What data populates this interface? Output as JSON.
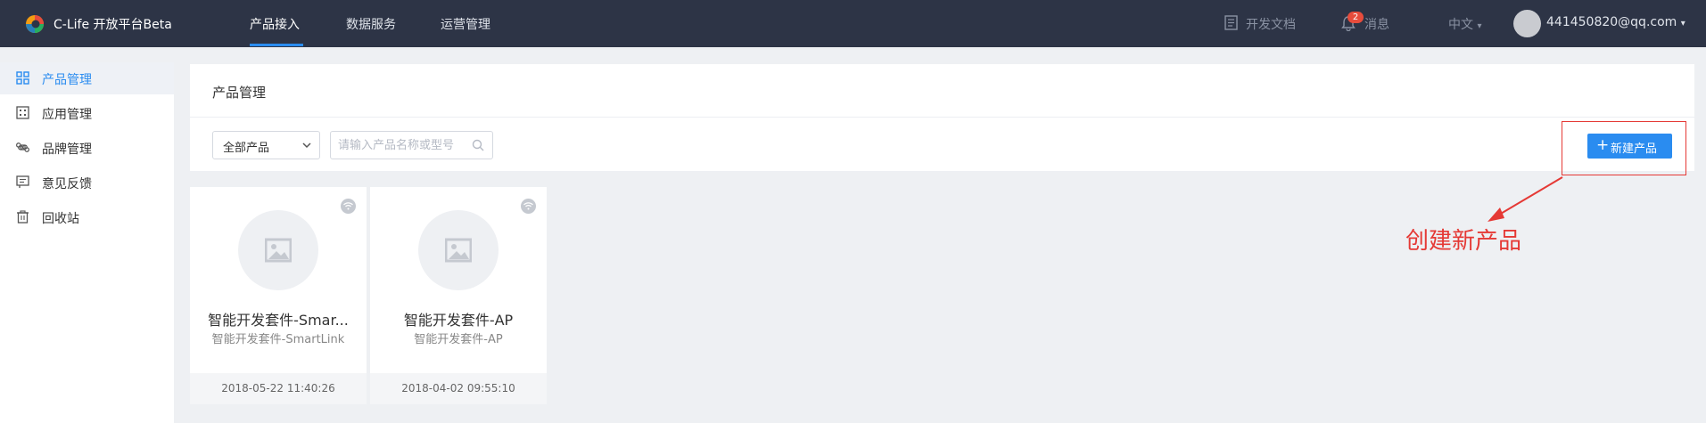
{
  "app": {
    "logo_text": "C-Life 开放平台Beta"
  },
  "topnav": {
    "items": [
      {
        "label": "产品接入",
        "active": true
      },
      {
        "label": "数据服务",
        "active": false
      },
      {
        "label": "运营管理",
        "active": false
      }
    ],
    "docs_label": "开发文档",
    "messages_label": "消息",
    "messages_count": "2",
    "language": "中文",
    "account": "441450820@qq.com"
  },
  "sidebar": {
    "items": [
      {
        "label": "产品管理",
        "icon": "grid-icon",
        "active": true
      },
      {
        "label": "应用管理",
        "icon": "app-icon",
        "active": false
      },
      {
        "label": "品牌管理",
        "icon": "command-icon",
        "active": false
      },
      {
        "label": "意见反馈",
        "icon": "feedback-icon",
        "active": false
      },
      {
        "label": "回收站",
        "icon": "trash-icon",
        "active": false
      }
    ]
  },
  "main": {
    "title": "产品管理",
    "filter": {
      "selected": "全部产品",
      "search_placeholder": "请输入产品名称或型号"
    },
    "new_button_label": "新建产品",
    "annotation": "创建新产品",
    "products": [
      {
        "name": "智能开发套件-Smar...",
        "model": "智能开发套件-SmartLink",
        "date": "2018-05-22 11:40:26"
      },
      {
        "name": "智能开发套件-AP",
        "model": "智能开发套件-AP",
        "date": "2018-04-02 09:55:10"
      }
    ]
  },
  "colors": {
    "topbar": "#2d3446",
    "accent": "#2a8cf0",
    "annotation": "#e53935",
    "page_bg": "#eef0f3"
  }
}
